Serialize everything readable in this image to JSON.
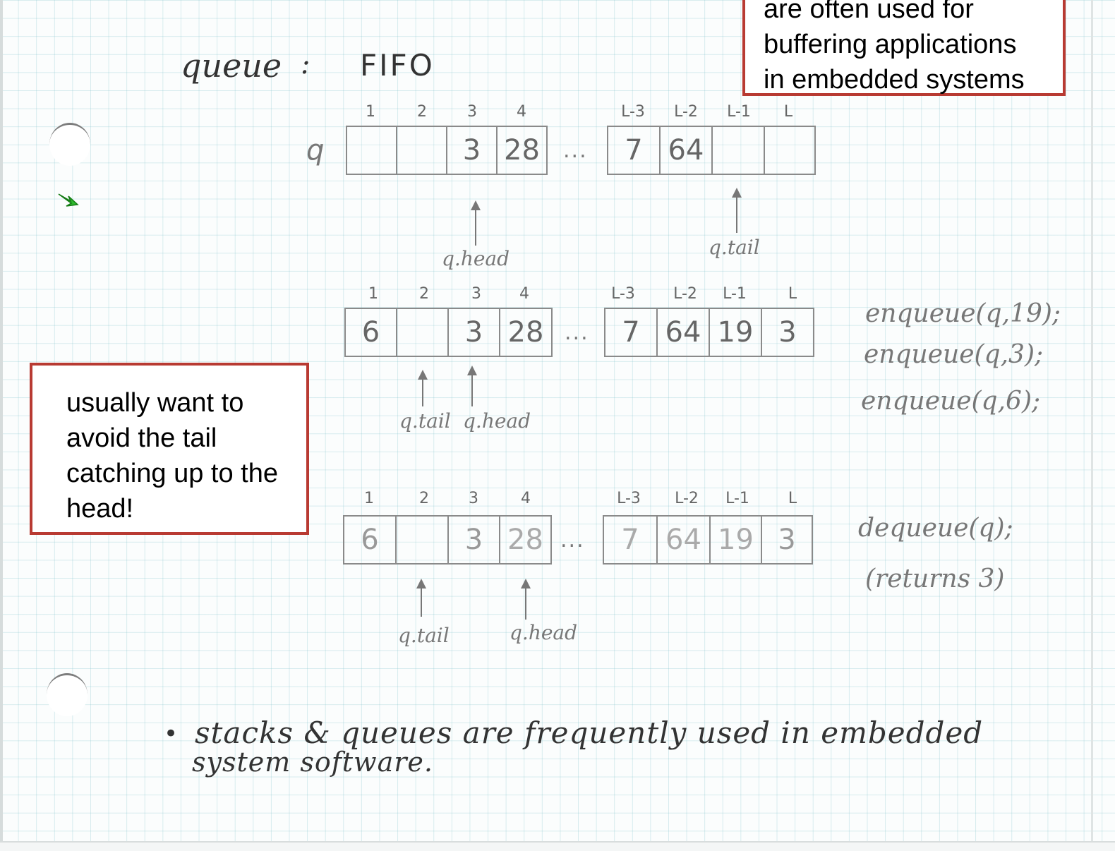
{
  "title": {
    "word": "queue",
    "colon": ":",
    "kind": "FIFO"
  },
  "indices": [
    "1",
    "2",
    "3",
    "4",
    "L-3",
    "L-2",
    "L-1",
    "L"
  ],
  "queue_name": "q",
  "ellipsis": "...",
  "rows": [
    {
      "cells": [
        "",
        "",
        "3",
        "28",
        "7",
        "64",
        "",
        ""
      ],
      "pointers": [
        {
          "name": "q.head",
          "label": "q.head"
        },
        {
          "name": "q.tail",
          "label": "q.tail"
        }
      ]
    },
    {
      "cells": [
        "6",
        "",
        "3",
        "28",
        "7",
        "64",
        "19",
        "3"
      ],
      "pointers": [
        {
          "name": "q.tail",
          "label": "q.tail"
        },
        {
          "name": "q.head",
          "label": "q.head"
        }
      ]
    },
    {
      "cells": [
        "6",
        "",
        "3",
        "28",
        "7",
        "64",
        "19",
        "3"
      ],
      "pointers": [
        {
          "name": "q.tail",
          "label": "q.tail"
        },
        {
          "name": "q.head",
          "label": "q.head"
        }
      ]
    }
  ],
  "operations": {
    "enqueue": [
      "enqueue(q,19);",
      "enqueue(q,3);",
      "enqueue(q,6);"
    ],
    "dequeue": "dequeue(q);",
    "returns": "(returns 3)"
  },
  "notes": {
    "top_right": [
      "are often used for",
      "buffering applications",
      "in embedded systems"
    ],
    "left": [
      "usually want to",
      "avoid the tail",
      "catching up to the",
      "head!"
    ]
  },
  "bullet": {
    "mark": "•",
    "line1": "stacks & queues are frequently used in embedded",
    "line2": "system software."
  },
  "colors": {
    "note_border": "#b83a32",
    "pointer_icon": "#2db82d"
  }
}
